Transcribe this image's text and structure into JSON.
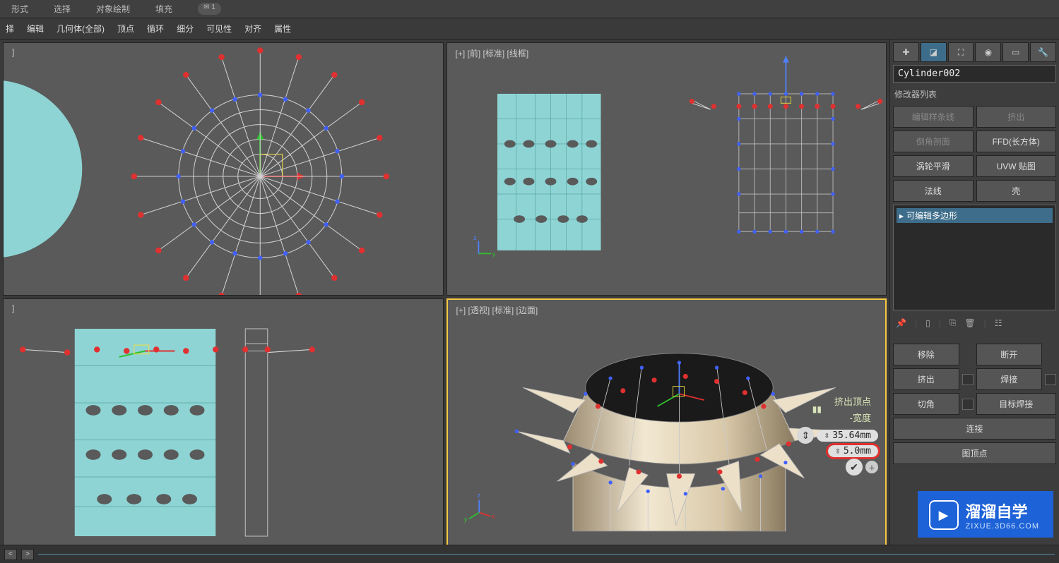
{
  "topMenu": {
    "items": [
      "形式",
      "选择",
      "对象绘制",
      "填充"
    ],
    "notif": "1"
  },
  "subMenu": {
    "items": [
      "择",
      "编辑",
      "几何体(全部)",
      "顶点",
      "循环",
      "细分",
      "可见性",
      "对齐",
      "属性"
    ]
  },
  "viewports": {
    "tl": {
      "label": ""
    },
    "tr": {
      "label": "[+] [前] [标准] [线框]"
    },
    "bl": {
      "label": ""
    },
    "br": {
      "label": "[+] [透视] [标准] [边面]"
    }
  },
  "panel": {
    "objectName": "Cylinder002",
    "sectionLabel": "修改器列表",
    "modButtons": [
      {
        "label": "编辑样条线",
        "disabled": true
      },
      {
        "label": "挤出",
        "disabled": true
      },
      {
        "label": "倒角剖面",
        "disabled": true
      },
      {
        "label": "FFD(长方体)",
        "disabled": false
      },
      {
        "label": "涡轮平滑",
        "disabled": false
      },
      {
        "label": "UVW 贴图",
        "disabled": false
      },
      {
        "label": "法线",
        "disabled": false
      },
      {
        "label": "壳",
        "disabled": false
      }
    ],
    "stackItem": "可编辑多边形",
    "edit": {
      "remove": "移除",
      "break": "断开",
      "extrude": "挤出",
      "weld": "焊接",
      "chamfer": "切角",
      "targetWeld": "目标焊接",
      "connect": "连接",
      "delTop": "图顶点"
    }
  },
  "caddy": {
    "title": "挤出顶点",
    "subtitle": "-宽度",
    "val1": "35.64mm",
    "val2": "5.0mm"
  },
  "watermark": {
    "big": "溜溜自学",
    "sub": "ZIXUE.3D66.COM"
  }
}
